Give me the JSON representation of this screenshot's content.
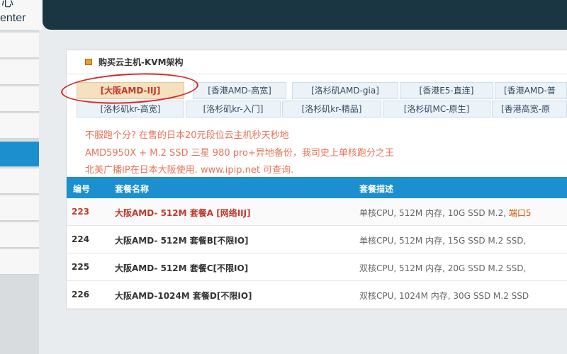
{
  "header": {
    "logo_cn": "心",
    "logo_en": "enter"
  },
  "panel": {
    "title": "购买云主机-KVM架构"
  },
  "tabs_row1": [
    "[大阪AMD-IIJ]",
    "[香港AMD-高宽]",
    "[洛杉矶AMD-gia]",
    "[香港E5-直连]",
    "[香港AMD-普"
  ],
  "tabs_row2": [
    "[洛杉矶kr-高宽]",
    "[洛杉矶kr-入门]",
    "[洛杉矶kr-精品]",
    "[洛杉矶MC-原生]",
    "[香港高宽-原"
  ],
  "notices": [
    "不服跑个分? 在售的日本20元段位云主机秒天秒地",
    "AMD5950X + M.2 SSD 三星 980 pro+异地备份，我司史上单核跑分之王",
    "北美广播IP在日本大阪使用. www.ipip.net 可查询."
  ],
  "table": {
    "headers": [
      "编号",
      "套餐名称",
      "套餐描述"
    ],
    "rows": [
      {
        "id": "223",
        "name": "大阪AMD- 512M 套餐A [网络IIJ]",
        "desc": "单核CPU, 512M 内存, 10G SSD M.2, ",
        "desc_tail": "端口5"
      },
      {
        "id": "224",
        "name": "大阪AMD- 512M 套餐B[不限IO]",
        "desc": "单核CPU, 512M 内存, 15G SSD M.2 SSD,",
        "desc_tail": ""
      },
      {
        "id": "225",
        "name": "大阪AMD- 512M 套餐C[不限IO]",
        "desc": "双核CPU, 512M 内存, 20G SSD M.2 SSD,",
        "desc_tail": ""
      },
      {
        "id": "226",
        "name": "大阪AMD-1024M 套餐D[不限IO]",
        "desc": "双核CPU, 1024M 内存, 30G SSD M.2 SSD",
        "desc_tail": ""
      }
    ]
  },
  "colors": {
    "header_bg": "#1a3643",
    "accent_blue": "#1c8fcf",
    "notice_orange": "#e8735a",
    "highlight_red": "#c0392b"
  }
}
